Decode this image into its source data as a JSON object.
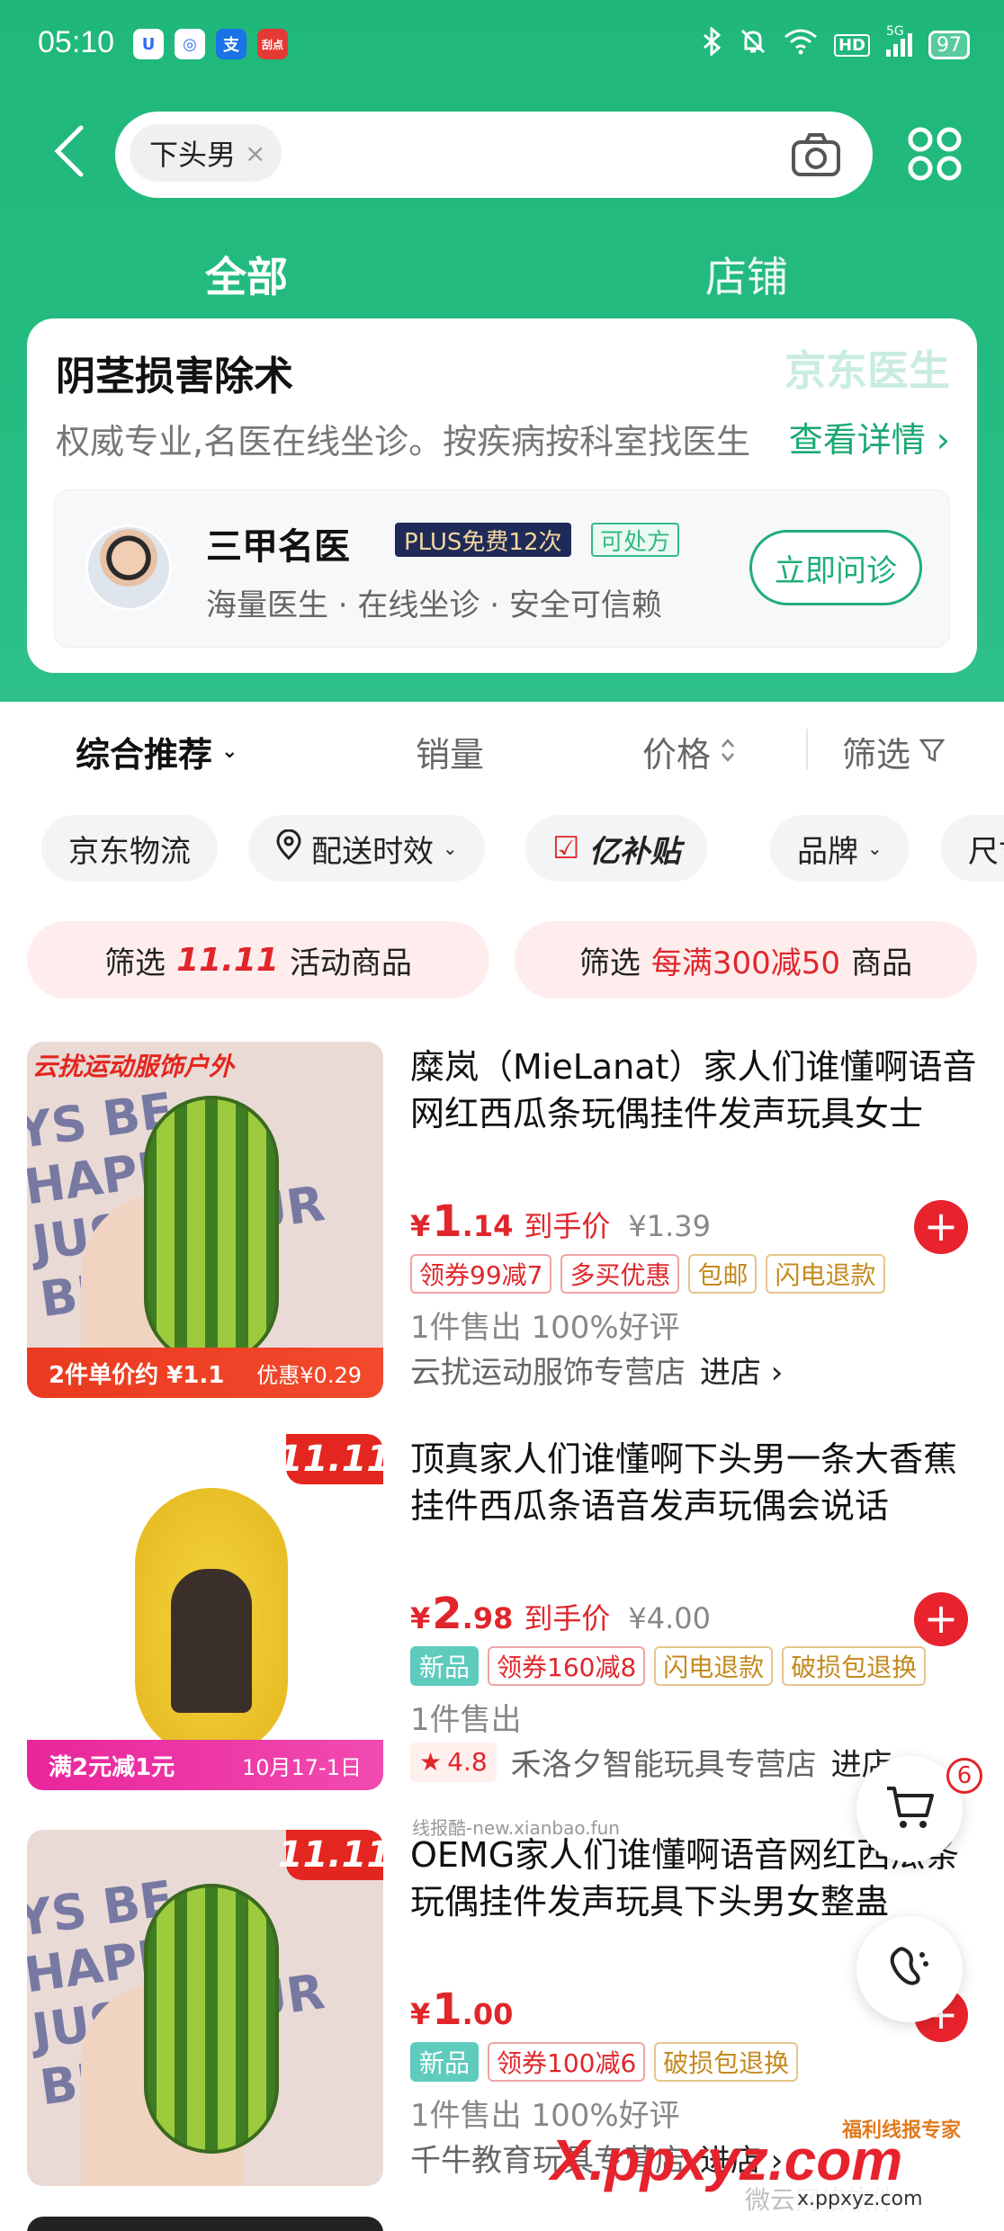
{
  "status_bar": {
    "time": "05:10",
    "app_icons": [
      {
        "name": "baidu-netdisk-icon",
        "glyph": "U",
        "color": "#2f6cf6"
      },
      {
        "name": "target-app-icon",
        "glyph": "◎",
        "color": "#2f6cf6"
      },
      {
        "name": "alipay-icon",
        "glyph": "支",
        "color": "#1a73e8"
      },
      {
        "name": "news-app-icon",
        "glyph": "刮点",
        "color": "#e53935"
      }
    ],
    "indicators": [
      "bluetooth-icon",
      "silent-icon",
      "wifi-icon",
      "hd-icon",
      "signal-5g-icon"
    ],
    "hd_label": "HD",
    "network_label": "5G",
    "battery": "97"
  },
  "search": {
    "query_chip": "下头男",
    "chip_clear": "×"
  },
  "tabs": [
    {
      "label": "全部",
      "active": true
    },
    {
      "label": "店铺",
      "active": false
    }
  ],
  "promo": {
    "title": "阴茎损害除术",
    "brand": "京东医生",
    "subtitle": "权威专业,名医在线坐诊。按疾病按科室找医生",
    "link": "查看详情 ›",
    "doctor": {
      "name": "三甲名医",
      "plus_badge": "PLUS免费12次",
      "rx_badge": "可处方",
      "desc": "海量医生 · 在线坐诊 · 安全可信赖",
      "button": "立即问诊"
    }
  },
  "sort": {
    "main": "综合推荐",
    "sales": "销量",
    "price": "价格",
    "filter": "筛选"
  },
  "filter_chips": [
    "京东物流",
    "配送时效",
    "亿补贴",
    "品牌",
    "尺寸"
  ],
  "activity_filters": [
    {
      "prefix": "筛选",
      "highlight": "11.11",
      "suffix": "活动商品"
    },
    {
      "prefix": "筛选",
      "highlight": "每满300减50",
      "suffix": "商品"
    }
  ],
  "products": [
    {
      "title": "糜岚（MieLanat）家人们谁懂啊语音网红西瓜条玩偶挂件发声玩具女士",
      "thumb_top_label": "云扰运动服饰户外",
      "thumb_bg_text": "YS BE HAPPY IT JUST YOUR BIRTH",
      "thumb_bottom_left": "2件单价约 ¥1.1",
      "thumb_bottom_right": "优惠¥0.29",
      "price_yen": "¥",
      "price_int": "1",
      "price_dec": ".14",
      "price_suffix": "到手价",
      "price_orig": "¥1.39",
      "tags": [
        {
          "text": "领券99减7",
          "style": "red-t"
        },
        {
          "text": "多买优惠",
          "style": "red-t"
        },
        {
          "text": "包邮",
          "style": "gold-t"
        },
        {
          "text": "闪电退款",
          "style": "gold-t"
        }
      ],
      "sold": "1件售出  100%好评",
      "shop": "云扰运动服饰专营店",
      "enter": "进店 ›"
    },
    {
      "title": "顶真家人们谁懂啊下头男一条大香蕉挂件西瓜条语音发声玩偶会说话",
      "badge": "11.11",
      "thumb_bottom_left": "满2元减1元",
      "thumb_bottom_right": "10月17-1日",
      "price_yen": "¥",
      "price_int": "2",
      "price_dec": ".98",
      "price_suffix": "到手价",
      "price_orig": "¥4.00",
      "tags": [
        {
          "text": "新品",
          "style": "teal-t"
        },
        {
          "text": "领券160减8",
          "style": "red-t"
        },
        {
          "text": "闪电退款",
          "style": "gold-t"
        },
        {
          "text": "破损包退换",
          "style": "gold-t"
        }
      ],
      "sold": "1件售出",
      "rating": "4.8",
      "shop": "禾洛夕智能玩具专营店",
      "enter": "进店 ›"
    },
    {
      "title": "OEMG家人们谁懂啊语音网红西瓜条玩偶挂件发声玩具下头男女整蛊",
      "badge": "11.11",
      "thumb_bg_text": "YS BE HAPPY IT JUST YOUR BIRTH",
      "price_yen": "¥",
      "price_int": "1",
      "price_dec": ".00",
      "tags": [
        {
          "text": "新品",
          "style": "teal-t"
        },
        {
          "text": "领券100减6",
          "style": "red-t"
        },
        {
          "text": "破损包退换",
          "style": "gold-t"
        }
      ],
      "sold": "1件售出  100%好评",
      "shop": "千牛教育玩具专营店",
      "enter": "进店 ›"
    }
  ],
  "floating": {
    "cart_count": "6"
  },
  "watermarks": {
    "small": "线报酷-new.xianbao.fun",
    "big": "X.ppxyz.com",
    "logo": "福利线报专家",
    "url": "x.ppxyz.com",
    "gray": "微云网络软件"
  },
  "colors": {
    "header_green": "#25bc82",
    "accent_red": "#e0262b",
    "link_green": "#19a872"
  }
}
